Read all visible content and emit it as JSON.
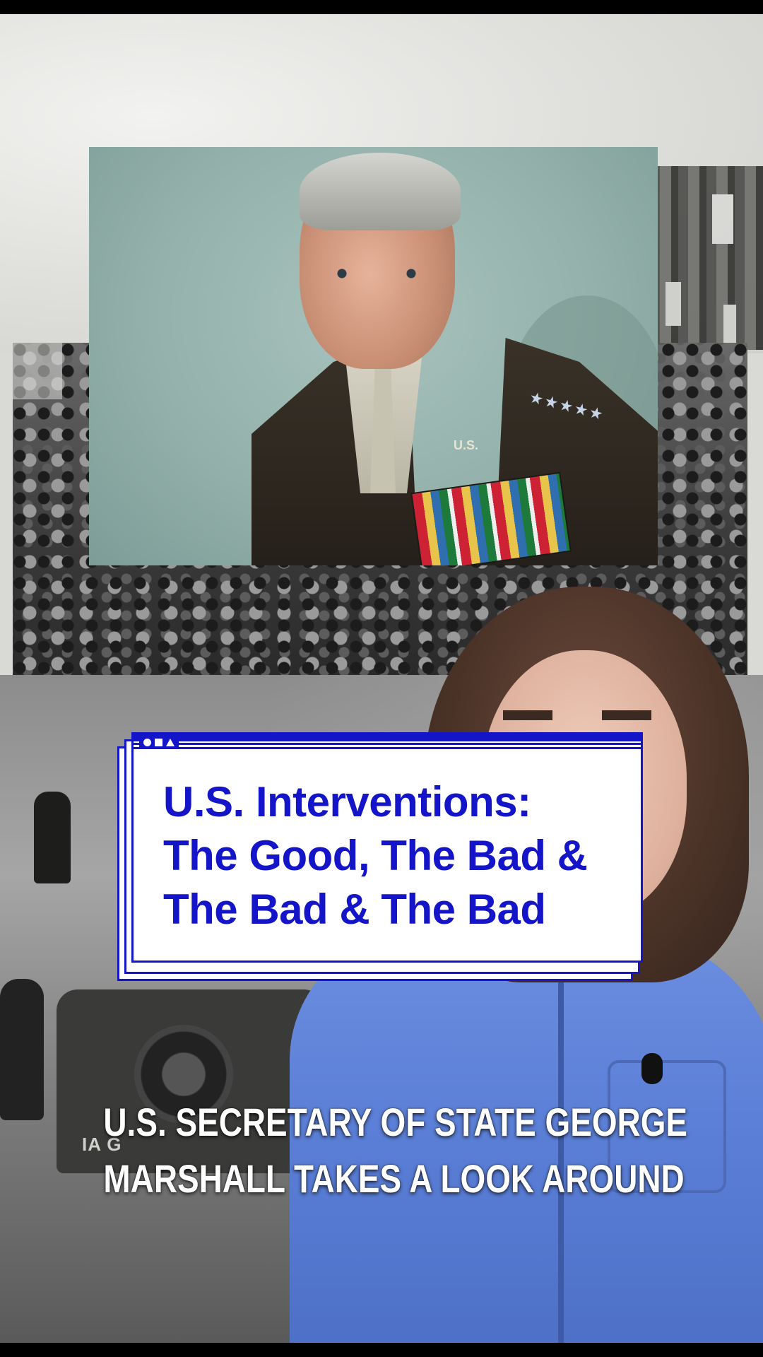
{
  "title_card": {
    "lines": [
      "U.S. Interventions:",
      "The Good, The Bad &",
      "The Bad & The Bad"
    ],
    "accent_color": "#1414c8",
    "window_controls": [
      "circle-icon",
      "square-icon",
      "triangle-icon"
    ]
  },
  "caption": {
    "lines": [
      "U.S. SECRETARY OF STATE GEORGE",
      "MARSHALL TAKES A LOOK AROUND"
    ]
  },
  "portrait": {
    "insignia_text": "U.S."
  },
  "background": {
    "vehicle_marking": "IA G"
  }
}
